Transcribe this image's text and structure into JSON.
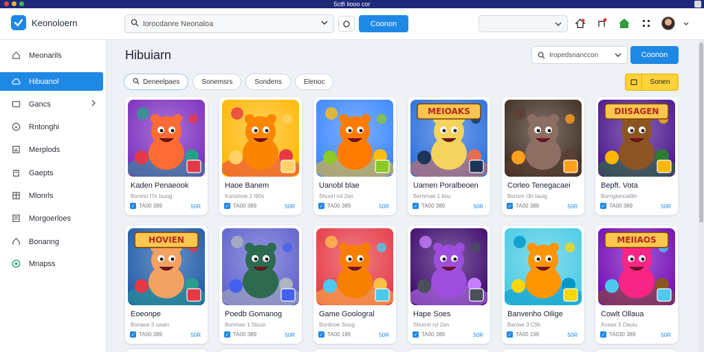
{
  "window": {
    "title": "5ctfi liooo cor",
    "dot_colors": [
      "#e24b4b",
      "#f2b62e",
      "#3fb950"
    ]
  },
  "header": {
    "app_name": "Keonoloern",
    "search_placeholder": "lorocdanre Neonaloa",
    "search_button": "Coonon",
    "select_value": "",
    "accent": "#1e88e5"
  },
  "sidebar": {
    "items": [
      {
        "label": "Meonarils",
        "icon": "home-icon"
      },
      {
        "label": "Hibuanol",
        "icon": "cloud-icon",
        "active": true
      },
      {
        "label": "Gancs",
        "icon": "gamepad-icon",
        "caret": true
      },
      {
        "label": "Rntonghi",
        "icon": "clock-icon"
      },
      {
        "label": "Merplods",
        "icon": "chart-icon"
      },
      {
        "label": "Gaepts",
        "icon": "list-icon"
      },
      {
        "label": "Mlonrls",
        "icon": "gift-icon"
      },
      {
        "label": "Morgoerloes",
        "icon": "bookmark-icon"
      },
      {
        "label": "Bonanng",
        "icon": "user-icon"
      },
      {
        "label": "Mnapss",
        "icon": "globe-icon"
      }
    ]
  },
  "main": {
    "title": "Hibuiarn",
    "search_placeholder": "Iropedsnanccon",
    "search_button": "Coonon",
    "filter_label": "Sonen",
    "chips": [
      "Deneelpaes",
      "Sonemsrs",
      "Sondens",
      "Elenoc"
    ]
  },
  "cards": [
    {
      "title": "Kaden Penaeook",
      "sub": "Bonmo I?n Isuog",
      "meta": "TA00 389",
      "link": "50R",
      "art": "A"
    },
    {
      "title": "Haoe Banem",
      "sub": "Konsinoe 2 I90s",
      "meta": "TA00 389",
      "link": "50R",
      "art": "B"
    },
    {
      "title": "Uanobl blae",
      "sub": "Shuorl rul 2an",
      "meta": "TA00 389",
      "link": "50R",
      "art": "C"
    },
    {
      "title": "Uamen Poralbeoen",
      "sub": "Bernmae 1 bou",
      "meta": "TA00 389",
      "link": "50R",
      "art": "D",
      "banner": "MEIOAKS"
    },
    {
      "title": "Corleo Tenegacaei",
      "sub": "Bonsm I3n Iauig",
      "meta": "TA00 389",
      "link": "50R",
      "art": "E"
    },
    {
      "title": "Bepft. Vota",
      "sub": "Burngloncaitlin",
      "meta": "TA00 389",
      "link": "50R",
      "art": "F",
      "banner": "DIISAGEN"
    },
    {
      "title": "Eoeonpe",
      "sub": "Bonaoe 3 oaaln",
      "meta": "TA00 389",
      "link": "50R",
      "art": "G",
      "banner": "HOVIEN"
    },
    {
      "title": "Poedb Gomanog",
      "sub": "Bonmae 1 Stuun",
      "meta": "TA00 389",
      "link": "50R",
      "art": "H"
    },
    {
      "title": "Game Goologral",
      "sub": "Burdnoe 3ioug",
      "meta": "TA00 189",
      "link": "50R",
      "art": "I"
    },
    {
      "title": "Hape Soes",
      "sub": "Shurrel ryl 2an",
      "meta": "TA00 389",
      "link": "50R",
      "art": "J"
    },
    {
      "title": "Banvenho Oilige",
      "sub": "Banlae 3 C9h",
      "meta": "TA00 199",
      "link": "50R",
      "art": "K"
    },
    {
      "title": "Cowlt Ollaua",
      "sub": "Aceae 3 Oauiu",
      "meta": "TA030 389",
      "link": "50R",
      "art": "L",
      "banner": "MEIIAOS"
    }
  ]
}
